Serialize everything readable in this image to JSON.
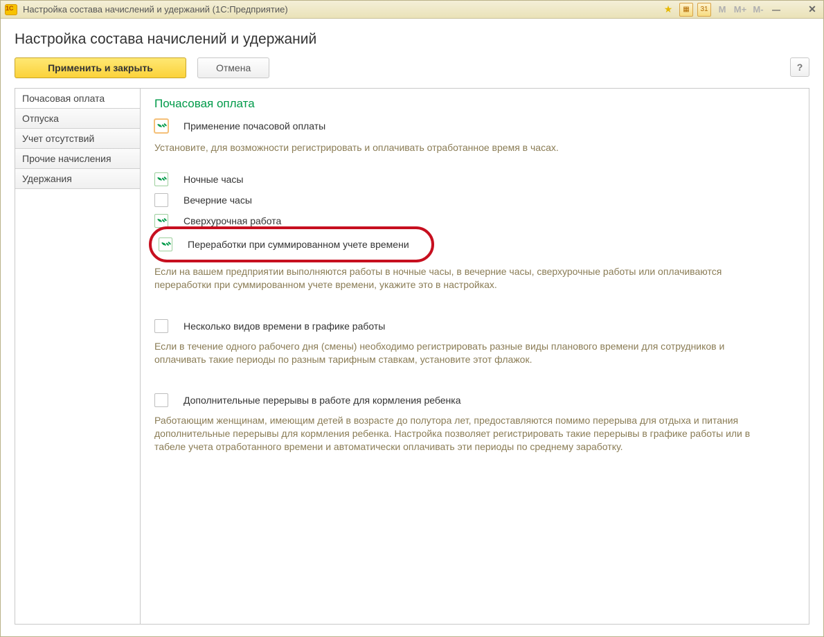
{
  "titlebar": {
    "title": "Настройка состава начислений и удержаний  (1С:Предприятие)",
    "m_buttons": [
      "M",
      "M+",
      "M-"
    ]
  },
  "page": {
    "title": "Настройка состава начислений и удержаний",
    "apply_close_label": "Применить и закрыть",
    "cancel_label": "Отмена",
    "help_label": "?"
  },
  "sidebar": {
    "tabs": [
      {
        "label": "Почасовая оплата",
        "active": true
      },
      {
        "label": "Отпуска",
        "active": false
      },
      {
        "label": "Учет отсутствий",
        "active": false
      },
      {
        "label": "Прочие начисления",
        "active": false
      },
      {
        "label": "Удержания",
        "active": false
      }
    ]
  },
  "panel": {
    "section_title": "Почасовая оплата",
    "feature": {
      "label": "Применение почасовой оплаты",
      "checked": true
    },
    "feature_hint": "Установите, для возможности регистрировать и оплачивать отработанное время в часах.",
    "options": [
      {
        "label": "Ночные часы",
        "checked": true
      },
      {
        "label": "Вечерние часы",
        "checked": false
      },
      {
        "label": "Сверхурочная работа",
        "checked": true
      },
      {
        "label": "Переработки при суммированном учете времени",
        "checked": true,
        "circled": true
      }
    ],
    "options_hint": "Если на вашем предприятии выполняются работы в ночные часы, в вечерние часы, сверхурочные работы или оплачиваются переработки при суммированном учете времени, укажите это в настройках.",
    "multi_time": {
      "label": "Несколько видов времени в графике работы",
      "checked": false,
      "hint": "Если в течение одного рабочего дня (смены) необходимо регистрировать разные виды планового времени для сотрудников и оплачивать такие периоды по разным тарифным ставкам, установите этот флажок."
    },
    "feeding_breaks": {
      "label": "Дополнительные перерывы в работе для кормления ребенка",
      "checked": false,
      "hint": "Работающим женщинам, имеющим детей в возрасте до полутора лет, предоставляются помимо перерыва для отдыха и питания дополнительные перерывы для кормления ребенка. Настройка позволяет регистрировать такие перерывы в графике работы или в табеле учета отработанного времени и автоматически оплачивать эти периоды по среднему заработку."
    }
  }
}
